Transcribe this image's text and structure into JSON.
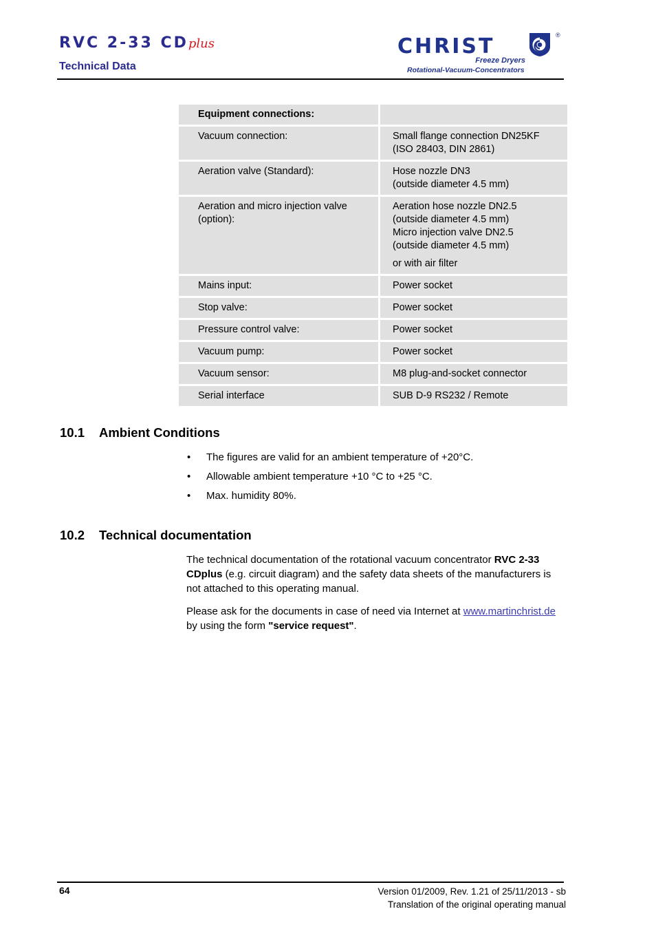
{
  "header": {
    "model_name": "RVC 2-33 CD",
    "model_suffix": "plus",
    "section_title": "Technical Data",
    "logo": {
      "wordmark": "CHRIST",
      "tagline_1": "Freeze Dryers",
      "tagline_2": "Rotational-Vacuum-Concentrators",
      "registered_mark": "®",
      "brand_color": "#20338c",
      "accent_color": "#d71920"
    }
  },
  "spec_table": {
    "section_header": "Equipment connections:",
    "rows": [
      {
        "label": "Vacuum connection:",
        "value_lines": [
          "Small flange connection DN25KF",
          "(ISO 28403, DIN 2861)"
        ]
      },
      {
        "label": "Aeration valve (Standard):",
        "value_lines": [
          "Hose nozzle DN3",
          "(outside diameter 4.5 mm)"
        ]
      },
      {
        "label": "Aeration and micro injection valve (option):",
        "label_lines": [
          "Aeration and micro injection valve",
          "(option):"
        ],
        "value_lines": [
          "Aeration hose nozzle DN2.5",
          "(outside diameter 4.5 mm)",
          "Micro injection valve DN2.5",
          "(outside diameter 4.5 mm)",
          "or with air filter"
        ]
      },
      {
        "label": "Mains input:",
        "value_lines": [
          "Power socket"
        ]
      },
      {
        "label": "Stop valve:",
        "value_lines": [
          "Power socket"
        ]
      },
      {
        "label": "Pressure control valve:",
        "value_lines": [
          "Power socket"
        ]
      },
      {
        "label": "Vacuum pump:",
        "value_lines": [
          "Power socket"
        ]
      },
      {
        "label": "Vacuum sensor:",
        "value_lines": [
          "M8 plug-and-socket connector"
        ]
      },
      {
        "label": "Serial interface",
        "value_lines": [
          "SUB D-9 RS232 / Remote"
        ]
      }
    ]
  },
  "sections": {
    "ambient": {
      "number": "10.1",
      "title": "Ambient Conditions",
      "bullet_char": "•",
      "bullets": [
        "The figures are valid for an ambient temperature of +20°C.",
        "Allowable ambient temperature  +10 °C to +25 °C.",
        "Max. humidity 80%."
      ]
    },
    "documentation": {
      "number": "10.2",
      "title": "Technical documentation",
      "paragraph_1": {
        "part_1": "The technical documentation of the rotational vacuum concentrator ",
        "bold_1": "RVC 2-33 CDplus",
        "part_2": " (e.g. circuit diagram) and the safety data sheets of the manufacturers is not attached to this operating manual."
      },
      "paragraph_2": {
        "part_1": "Please ask for the documents in case of need via Internet at ",
        "link": "www.martinchrist.de",
        "part_2": " by using the form ",
        "bold_1": "\"service request\"",
        "part_3": "."
      }
    }
  },
  "footer": {
    "page_number": "64",
    "version_line": "Version 01/2009, Rev. 1.21 of 25/11/2013 - sb",
    "translation_line": "Translation of the original operating manual"
  }
}
